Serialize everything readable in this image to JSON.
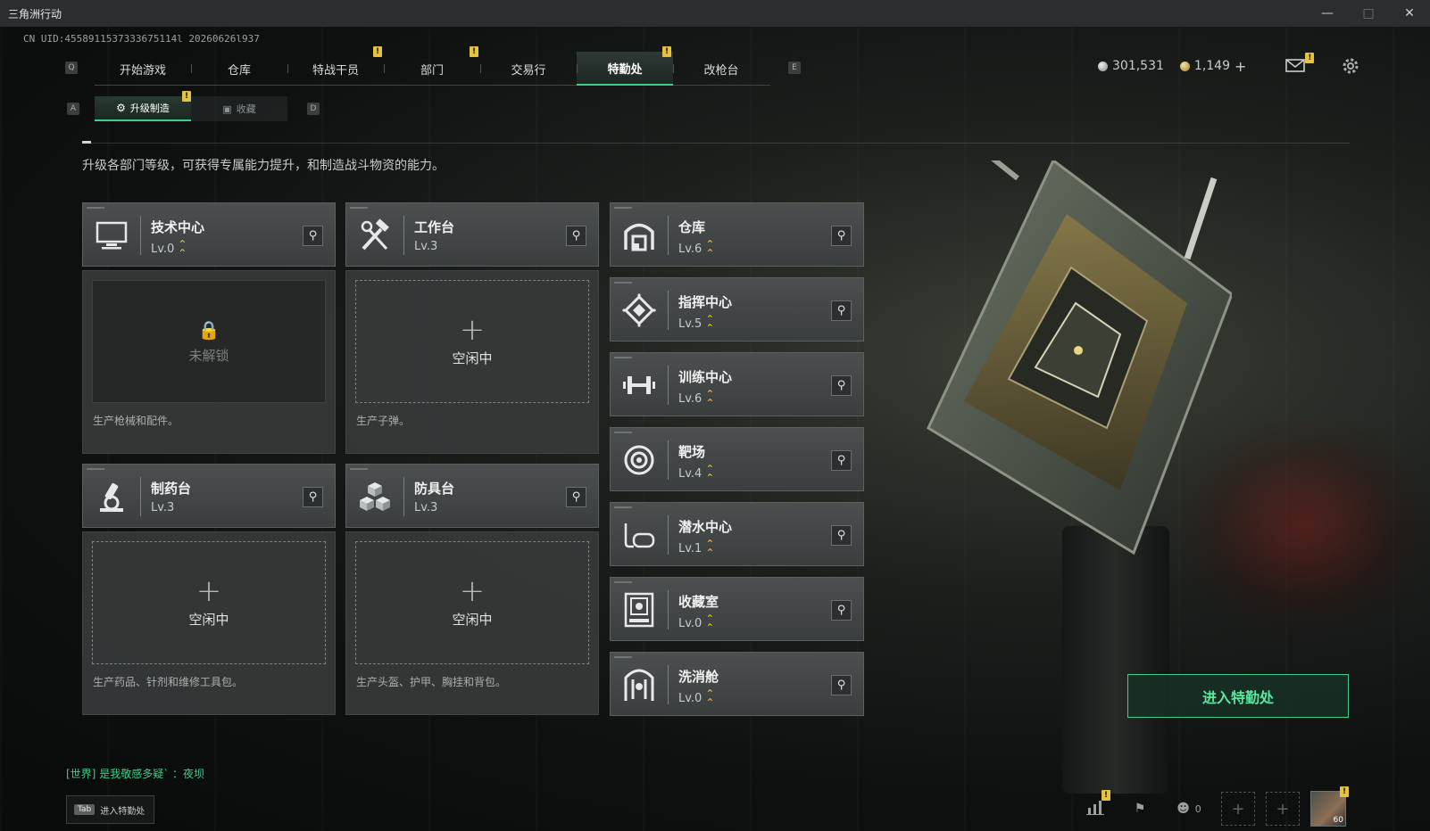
{
  "window": {
    "title": "三角洲行动"
  },
  "uid_text": "CN UID:4558911537333675114l 20260626l937",
  "nav": {
    "left_key": "Q",
    "right_key": "E",
    "tabs": [
      {
        "label": "开始游戏",
        "badge": ""
      },
      {
        "label": "仓库",
        "badge": ""
      },
      {
        "label": "特战干员",
        "badge": "!"
      },
      {
        "label": "部门",
        "badge": "!"
      },
      {
        "label": "交易行",
        "badge": ""
      },
      {
        "label": "特勤处",
        "badge": "!",
        "active": true
      },
      {
        "label": "改枪台",
        "badge": ""
      }
    ]
  },
  "subnav": {
    "left_key": "A",
    "right_key": "D",
    "tabs": [
      {
        "label": "升级制造",
        "active": true,
        "badge": "!"
      },
      {
        "label": "收藏",
        "active": false
      }
    ]
  },
  "currency": {
    "silver": "301,531",
    "gold": "1,149",
    "add": "+"
  },
  "description": "升级各部门等级，可获得专属能力提升，和制造战斗物资的能力。",
  "production": [
    {
      "name": "技术中心",
      "level": "Lv.0",
      "icon": "monitor-icon",
      "slot_status": "未解锁",
      "locked": true,
      "caption": "生产枪械和配件。"
    },
    {
      "name": "工作台",
      "level": "Lv.3",
      "icon": "hammer-wrench-icon",
      "slot_status": "空闲中",
      "locked": false,
      "caption": "生产子弹。"
    },
    {
      "name": "制药台",
      "level": "Lv.3",
      "icon": "microscope-icon",
      "slot_status": "空闲中",
      "locked": false,
      "caption": "生产药品、针剂和维修工具包。"
    },
    {
      "name": "防具台",
      "level": "Lv.3",
      "icon": "cubes-icon",
      "slot_status": "空闲中",
      "locked": false,
      "caption": "生产头盔、护甲、胸挂和背包。"
    }
  ],
  "facilities": [
    {
      "name": "仓库",
      "level": "Lv.6",
      "icon": "warehouse-icon"
    },
    {
      "name": "指挥中心",
      "level": "Lv.5",
      "icon": "chip-icon"
    },
    {
      "name": "训练中心",
      "level": "Lv.6",
      "icon": "dumbbell-icon"
    },
    {
      "name": "靶场",
      "level": "Lv.4",
      "icon": "target-icon"
    },
    {
      "name": "潜水中心",
      "level": "Lv.1",
      "icon": "diving-mask-icon"
    },
    {
      "name": "收藏室",
      "level": "Lv.0",
      "icon": "collection-room-icon"
    },
    {
      "name": "洗消舱",
      "level": "Lv.0",
      "icon": "decontamination-icon"
    }
  ],
  "enter_button": "进入特勤处",
  "chat": {
    "channel": "[世界]",
    "message": "是我敬感多疑` ：夜坝"
  },
  "tab_hint": {
    "key": "Tab",
    "label": "进入特勤处"
  },
  "squad_count": "0",
  "avatar_level": "60",
  "colors": {
    "accent": "#3ecf8a",
    "badge": "#e5c342",
    "level_arrow": "#e5c342"
  }
}
